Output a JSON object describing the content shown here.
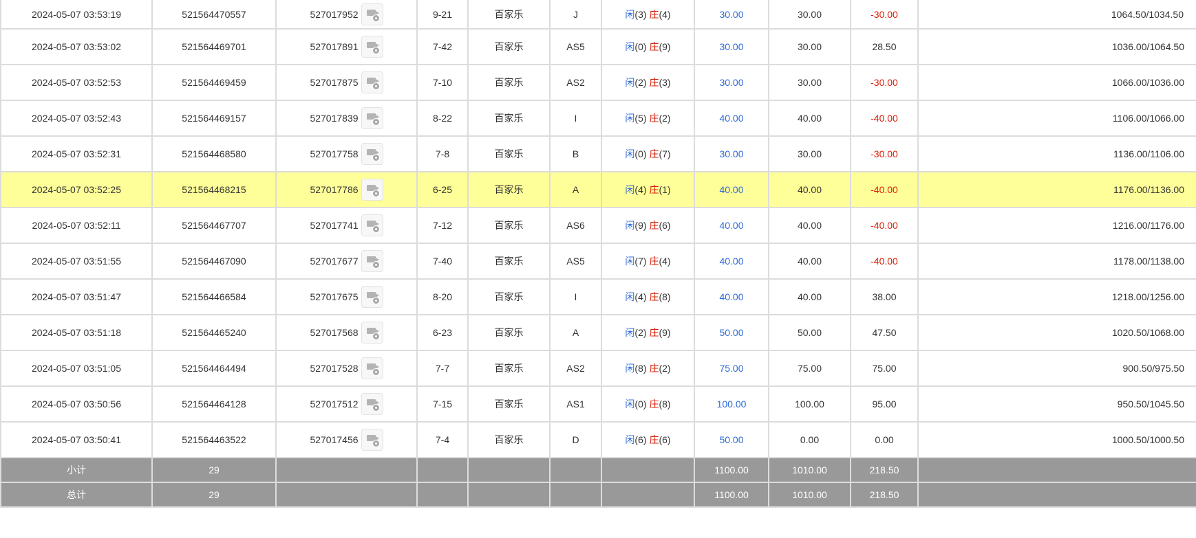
{
  "colors": {
    "blue": "#2e6bd6",
    "red": "#d81e06",
    "highlight": "#ffff99",
    "footer": "#999999"
  },
  "icons": {
    "replay": "video-replay-icon"
  },
  "labels": {
    "player": "闲",
    "banker": "庄"
  },
  "rows": [
    {
      "time": "2024-05-07 03:53:19",
      "bet_no": "521564470557",
      "round": "527017952",
      "shoe": "9-21",
      "game": "百家乐",
      "table": "J",
      "player": "(3)",
      "banker": "(4)",
      "bet": "30.00",
      "valid": "30.00",
      "win": "-30.00",
      "win_neg": true,
      "balance": "1064.50/1034.50"
    },
    {
      "time": "2024-05-07 03:53:02",
      "bet_no": "521564469701",
      "round": "527017891",
      "shoe": "7-42",
      "game": "百家乐",
      "table": "AS5",
      "player": "(0)",
      "banker": "(9)",
      "bet": "30.00",
      "valid": "30.00",
      "win": "28.50",
      "win_neg": false,
      "balance": "1036.00/1064.50"
    },
    {
      "time": "2024-05-07 03:52:53",
      "bet_no": "521564469459",
      "round": "527017875",
      "shoe": "7-10",
      "game": "百家乐",
      "table": "AS2",
      "player": "(2)",
      "banker": "(3)",
      "bet": "30.00",
      "valid": "30.00",
      "win": "-30.00",
      "win_neg": true,
      "balance": "1066.00/1036.00"
    },
    {
      "time": "2024-05-07 03:52:43",
      "bet_no": "521564469157",
      "round": "527017839",
      "shoe": "8-22",
      "game": "百家乐",
      "table": "I",
      "player": "(5)",
      "banker": "(2)",
      "bet": "40.00",
      "valid": "40.00",
      "win": "-40.00",
      "win_neg": true,
      "balance": "1106.00/1066.00"
    },
    {
      "time": "2024-05-07 03:52:31",
      "bet_no": "521564468580",
      "round": "527017758",
      "shoe": "7-8",
      "game": "百家乐",
      "table": "B",
      "player": "(0)",
      "banker": "(7)",
      "bet": "30.00",
      "valid": "30.00",
      "win": "-30.00",
      "win_neg": true,
      "balance": "1136.00/1106.00"
    },
    {
      "time": "2024-05-07 03:52:25",
      "bet_no": "521564468215",
      "round": "527017786",
      "shoe": "6-25",
      "game": "百家乐",
      "table": "A",
      "player": "(4)",
      "banker": "(1)",
      "bet": "40.00",
      "valid": "40.00",
      "win": "-40.00",
      "win_neg": true,
      "balance": "1176.00/1136.00",
      "highlight": true
    },
    {
      "time": "2024-05-07 03:52:11",
      "bet_no": "521564467707",
      "round": "527017741",
      "shoe": "7-12",
      "game": "百家乐",
      "table": "AS6",
      "player": "(9)",
      "banker": "(6)",
      "bet": "40.00",
      "valid": "40.00",
      "win": "-40.00",
      "win_neg": true,
      "balance": "1216.00/1176.00"
    },
    {
      "time": "2024-05-07 03:51:55",
      "bet_no": "521564467090",
      "round": "527017677",
      "shoe": "7-40",
      "game": "百家乐",
      "table": "AS5",
      "player": "(7)",
      "banker": "(4)",
      "bet": "40.00",
      "valid": "40.00",
      "win": "-40.00",
      "win_neg": true,
      "balance": "1178.00/1138.00"
    },
    {
      "time": "2024-05-07 03:51:47",
      "bet_no": "521564466584",
      "round": "527017675",
      "shoe": "8-20",
      "game": "百家乐",
      "table": "I",
      "player": "(4)",
      "banker": "(8)",
      "bet": "40.00",
      "valid": "40.00",
      "win": "38.00",
      "win_neg": false,
      "balance": "1218.00/1256.00"
    },
    {
      "time": "2024-05-07 03:51:18",
      "bet_no": "521564465240",
      "round": "527017568",
      "shoe": "6-23",
      "game": "百家乐",
      "table": "A",
      "player": "(2)",
      "banker": "(9)",
      "bet": "50.00",
      "valid": "50.00",
      "win": "47.50",
      "win_neg": false,
      "balance": "1020.50/1068.00"
    },
    {
      "time": "2024-05-07 03:51:05",
      "bet_no": "521564464494",
      "round": "527017528",
      "shoe": "7-7",
      "game": "百家乐",
      "table": "AS2",
      "player": "(8)",
      "banker": "(2)",
      "bet": "75.00",
      "valid": "75.00",
      "win": "75.00",
      "win_neg": false,
      "balance": "900.50/975.50"
    },
    {
      "time": "2024-05-07 03:50:56",
      "bet_no": "521564464128",
      "round": "527017512",
      "shoe": "7-15",
      "game": "百家乐",
      "table": "AS1",
      "player": "(0)",
      "banker": "(8)",
      "bet": "100.00",
      "valid": "100.00",
      "win": "95.00",
      "win_neg": false,
      "balance": "950.50/1045.50"
    },
    {
      "time": "2024-05-07 03:50:41",
      "bet_no": "521564463522",
      "round": "527017456",
      "shoe": "7-4",
      "game": "百家乐",
      "table": "D",
      "player": "(6)",
      "banker": "(6)",
      "bet": "50.00",
      "valid": "0.00",
      "win": "0.00",
      "win_neg": false,
      "balance": "1000.50/1000.50"
    }
  ],
  "subtotal": {
    "label": "小计",
    "count": "29",
    "bet": "1100.00",
    "valid": "1010.00",
    "win": "218.50"
  },
  "total": {
    "label": "总计",
    "count": "29",
    "bet": "1100.00",
    "valid": "1010.00",
    "win": "218.50"
  }
}
